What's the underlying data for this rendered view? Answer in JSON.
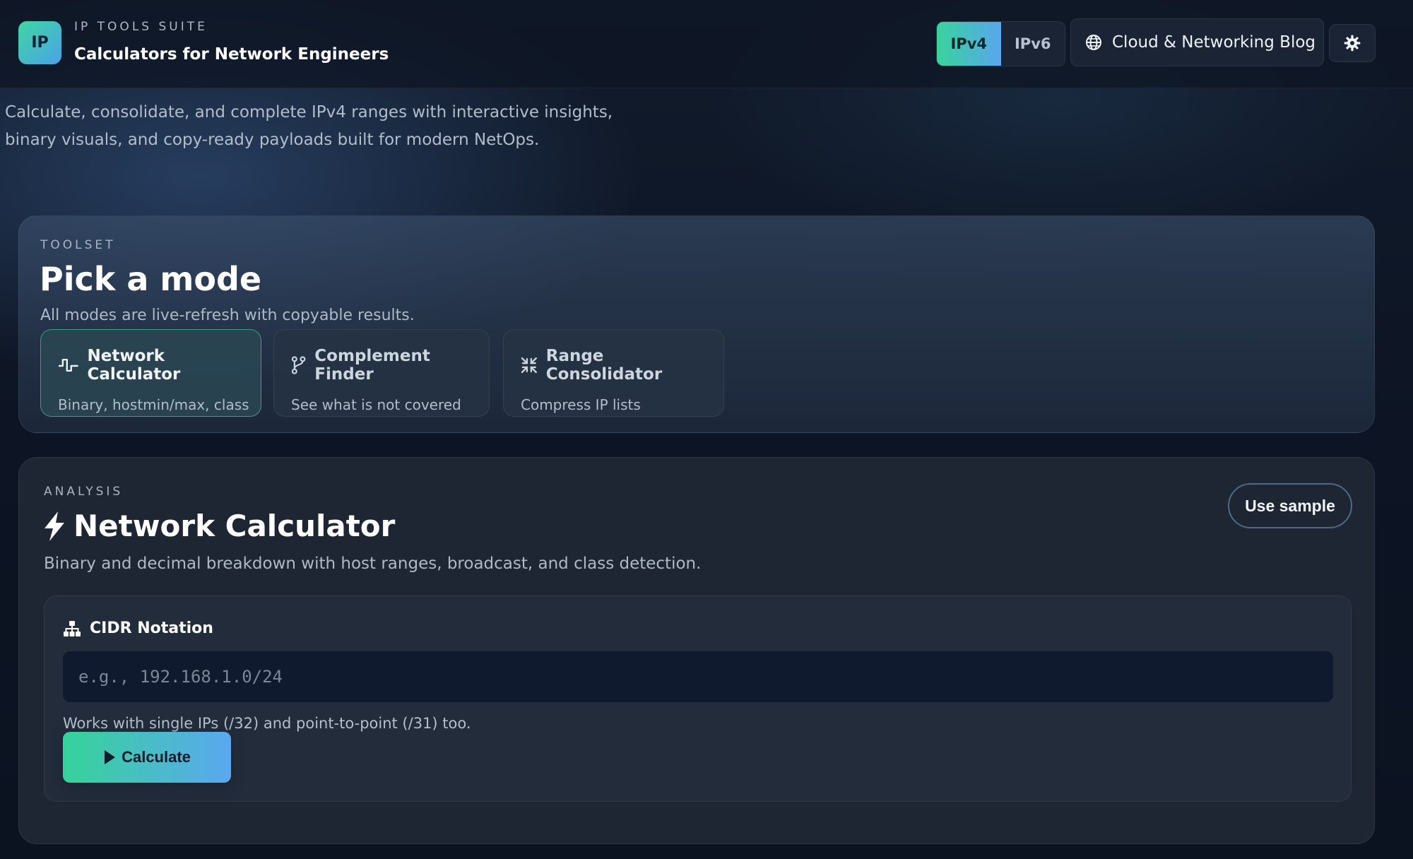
{
  "header": {
    "logo": "IP",
    "kicker": "IP TOOLS SUITE",
    "title": "Calculators for Network Engineers",
    "versions": [
      {
        "label": "IPv4",
        "active": true
      },
      {
        "label": "IPv6",
        "active": false
      }
    ],
    "blog_label": "Cloud & Networking Blog",
    "icons": {
      "blog": "globe-icon",
      "settings": "gear-icon"
    }
  },
  "intro": {
    "line1": "Calculate, consolidate, and complete IPv4 ranges with interactive insights,",
    "line2": "binary visuals, and copy-ready payloads built for modern NetOps."
  },
  "toolset": {
    "kicker": "TOOLSET",
    "title": "Pick a mode",
    "subtitle": "All modes are live-refresh with copyable results.",
    "modes": [
      {
        "title": "Network Calculator",
        "desc": "Binary, hostmin/max, class",
        "icon": "pulse-icon",
        "active": true
      },
      {
        "title": "Complement Finder",
        "desc": "See what is not covered",
        "icon": "branch-icon",
        "active": false
      },
      {
        "title": "Range Consolidator",
        "desc": "Compress IP lists",
        "icon": "compress-icon",
        "active": false
      }
    ]
  },
  "analysis": {
    "kicker": "ANALYSIS",
    "title": "Network Calculator",
    "subtitle": "Binary and decimal breakdown with host ranges, broadcast, and class detection.",
    "sample_label": "Use sample",
    "field_label": "CIDR Notation",
    "input_value": "",
    "input_placeholder": "e.g., 192.168.1.0/24",
    "hint": "Works with single IPs (/32) and point-to-point (/31) too.",
    "calculate_label": "Calculate",
    "icons": {
      "title": "bolt-icon",
      "field": "sitemap-icon",
      "calculate": "play-icon"
    }
  },
  "colors": {
    "accent_start": "#38d39c",
    "accent_end": "#5aa6ee",
    "background": "#0c1320"
  }
}
